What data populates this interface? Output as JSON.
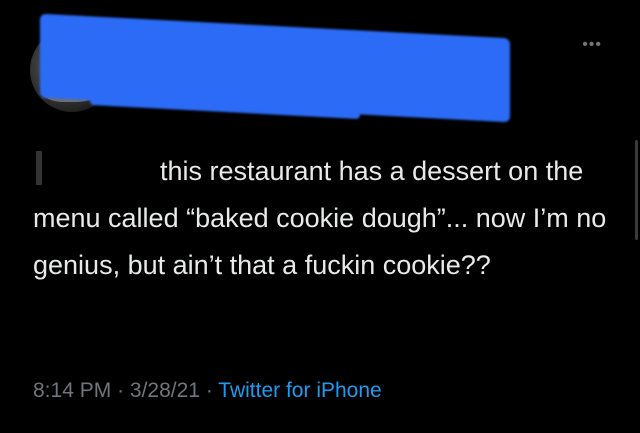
{
  "tweet": {
    "text": "this restaurant has a dessert on the menu called “baked cookie dough”... now I’m no genius, but ain’t that a fuckin cookie??",
    "time": "8:14 PM",
    "date": "3/28/21",
    "separator": "·",
    "source": "Twitter for iPhone",
    "more_icon": "more-icon"
  },
  "colors": {
    "background": "#000000",
    "text": "#e7e9ea",
    "meta": "#71767b",
    "link": "#1d9bf0",
    "redaction": "#2c6bf5"
  }
}
